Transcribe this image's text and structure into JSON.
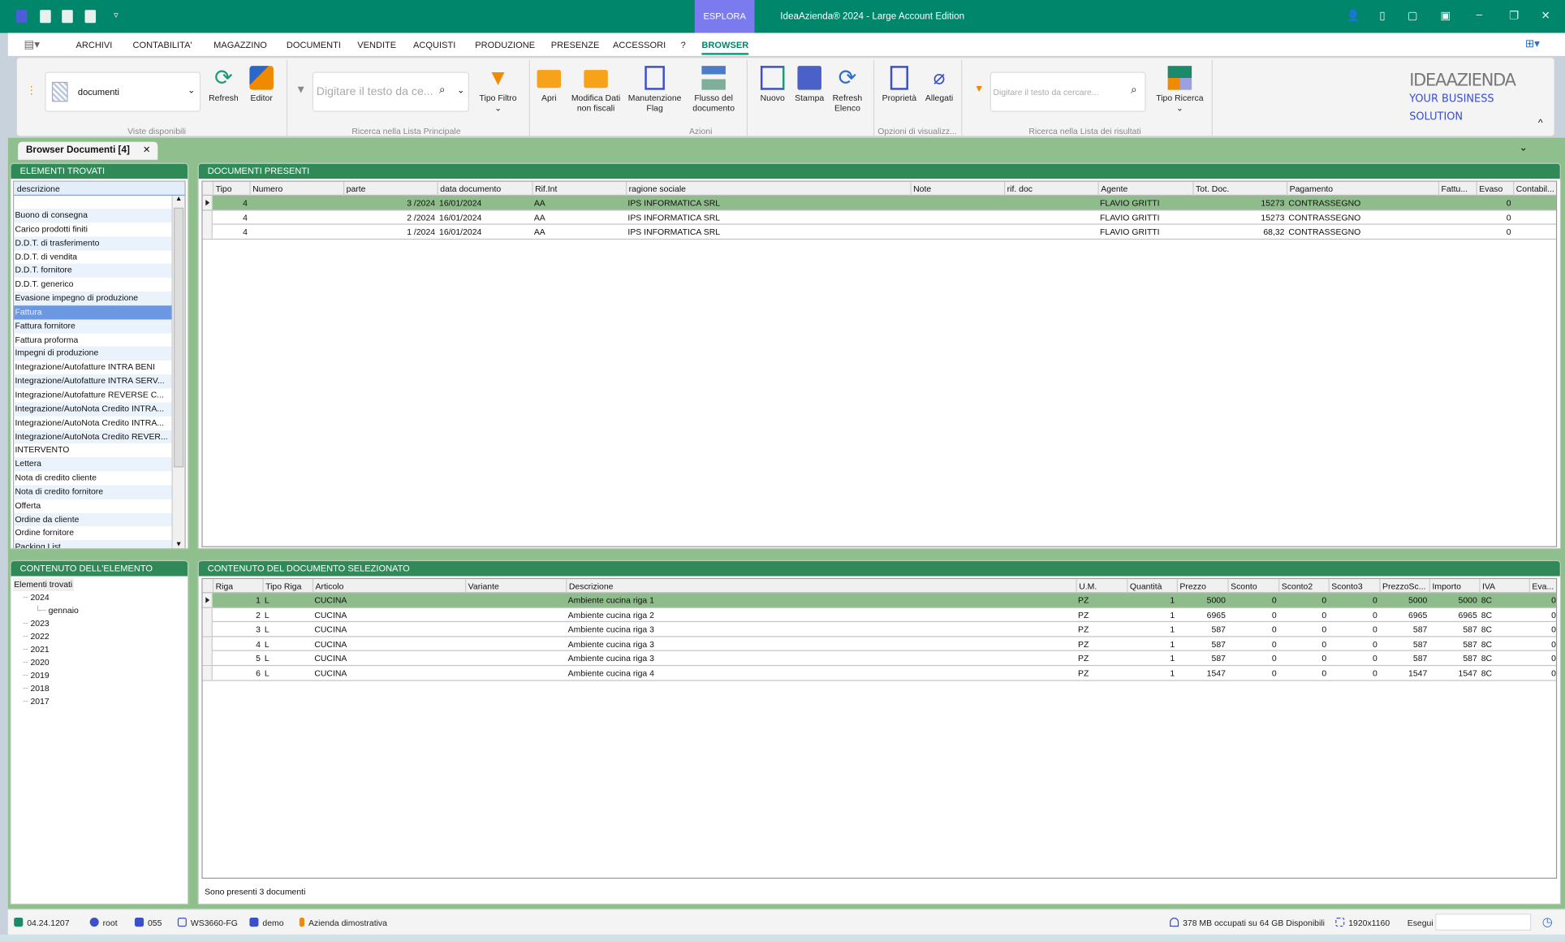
{
  "titlebar": {
    "title": "IdeaAzienda® 2024 - Large Account Edition",
    "context_tab": "ESPLORA",
    "quick_icons": [
      "app-icon",
      "calculator-icon",
      "print-preview-icon",
      "excel-icon",
      "customize-icon"
    ],
    "window_icons": [
      "user-icon",
      "document-search-icon",
      "help-icon",
      "pin-icon",
      "minimize-icon",
      "restore-icon",
      "close-icon"
    ]
  },
  "menu": {
    "items": [
      "ARCHIVI",
      "CONTABILITA'",
      "MAGAZZINO",
      "DOCUMENTI",
      "VENDITE",
      "ACQUISTI",
      "PRODUZIONE",
      "PRESENZE",
      "ACCESSORI",
      "?",
      "BROWSER"
    ],
    "active": "BROWSER"
  },
  "ribbon": {
    "views_combo": "documenti",
    "views_group": "Viste disponibili",
    "refresh": "Refresh",
    "editor": "Editor",
    "search_placeholder": "Digitare il testo da ce...",
    "search_group": "Ricerca nella Lista Principale",
    "filter_type": "Tipo Filtro",
    "actions": {
      "open": "Apri",
      "edit_nonfiscal": "Modifica Dati non fiscali",
      "flag": "Manutenzione Flag",
      "flow": "Flusso del documento",
      "new": "Nuovo",
      "print": "Stampa",
      "refresh_list": "Refresh Elenco"
    },
    "actions_group": "Azioni",
    "properties": "Proprietà",
    "attachments": "Allegati",
    "view_group": "Opzioni di visualizz...",
    "result_search_placeholder": "Digitare il testo da cercare...",
    "result_group": "Ricerca nella Lista dei risultati",
    "search_type": "Tipo Ricerca",
    "logo": "IDEAAZIENDA YOUR BUSINESS SOLUTION"
  },
  "doc_tab": {
    "label": "Browser Documenti [4]"
  },
  "elements_panel": {
    "title": "ELEMENTI TROVATI",
    "column": "descrizione",
    "selected": "Fattura",
    "items": [
      "Buono di consegna",
      "Carico prodotti finiti",
      "D.D.T. di trasferimento",
      "D.D.T. di vendita",
      "D.D.T. fornitore",
      "D.D.T. generico",
      "Evasione impegno di produzione",
      "Fattura",
      "Fattura fornitore",
      "Fattura proforma",
      "Impegni di produzione",
      "Integrazione/Autofatture INTRA BENI",
      "Integrazione/Autofatture INTRA SERV...",
      "Integrazione/Autofatture REVERSE C...",
      "Integrazione/AutoNota Credito INTRA...",
      "Integrazione/AutoNota Credito INTRA...",
      "Integrazione/AutoNota Credito REVER...",
      "INTERVENTO",
      "Lettera",
      "Nota di credito cliente",
      "Nota di credito fornitore",
      "Offerta",
      "Ordine da cliente",
      "Ordine fornitore",
      "Packing List"
    ]
  },
  "documents_panel": {
    "title": "DOCUMENTI PRESENTI",
    "columns": [
      "Tipo",
      "Numero",
      "parte",
      "data documento",
      "Rif.Int",
      "ragione sociale",
      "Note",
      "rif. doc",
      "Agente",
      "Tot. Doc.",
      "Pagamento",
      "Fattu...",
      "Evaso",
      "Contabil..."
    ],
    "rows": [
      [
        "4",
        "",
        "3 /2024",
        "16/01/2024",
        "AA",
        "IPS INFORMATICA SRL",
        "",
        "",
        "FLAVIO GRITTI",
        "15273",
        "CONTRASSEGNO",
        "",
        "0",
        ""
      ],
      [
        "4",
        "",
        "2 /2024",
        "16/01/2024",
        "AA",
        "IPS INFORMATICA SRL",
        "",
        "",
        "FLAVIO GRITTI",
        "15273",
        "CONTRASSEGNO",
        "",
        "0",
        ""
      ],
      [
        "4",
        "",
        "1 /2024",
        "16/01/2024",
        "AA",
        "IPS INFORMATICA SRL",
        "",
        "",
        "FLAVIO GRITTI",
        "68,32",
        "CONTRASSEGNO",
        "",
        "0",
        ""
      ]
    ]
  },
  "tree_panel": {
    "title": "CONTENUTO DELL'ELEMENTO SCELTO",
    "root": "Elementi trovati",
    "nodes": [
      {
        "label": "2024",
        "level": 1
      },
      {
        "label": "gennaio",
        "level": 2
      },
      {
        "label": "2023",
        "level": 1
      },
      {
        "label": "2022",
        "level": 1
      },
      {
        "label": "2021",
        "level": 1
      },
      {
        "label": "2020",
        "level": 1
      },
      {
        "label": "2019",
        "level": 1
      },
      {
        "label": "2018",
        "level": 1
      },
      {
        "label": "2017",
        "level": 1
      }
    ]
  },
  "lines_panel": {
    "title": "CONTENUTO DEL DOCUMENTO SELEZIONATO",
    "columns": [
      "Riga",
      "Tipo Riga",
      "Articolo",
      "Variante",
      "Descrizione",
      "U.M.",
      "Quantità",
      "Prezzo",
      "Sconto",
      "Sconto2",
      "Sconto3",
      "PrezzoSc...",
      "Importo",
      "IVA",
      "Eva..."
    ],
    "rows": [
      [
        "1",
        "L",
        "CUCINA",
        "",
        "Ambiente cucina riga 1",
        "PZ",
        "1",
        "5000",
        "0",
        "0",
        "0",
        "5000",
        "5000",
        "8C",
        "0"
      ],
      [
        "2",
        "L",
        "CUCINA",
        "",
        "Ambiente cucina riga 2",
        "PZ",
        "1",
        "6965",
        "0",
        "0",
        "0",
        "6965",
        "6965",
        "8C",
        "0"
      ],
      [
        "3",
        "L",
        "CUCINA",
        "",
        "Ambiente cucina riga 3",
        "PZ",
        "1",
        "587",
        "0",
        "0",
        "0",
        "587",
        "587",
        "8C",
        "0"
      ],
      [
        "4",
        "L",
        "CUCINA",
        "",
        "Ambiente cucina riga 3",
        "PZ",
        "1",
        "587",
        "0",
        "0",
        "0",
        "587",
        "587",
        "8C",
        "0"
      ],
      [
        "5",
        "L",
        "CUCINA",
        "",
        "Ambiente cucina riga 3",
        "PZ",
        "1",
        "587",
        "0",
        "0",
        "0",
        "587",
        "587",
        "8C",
        "0"
      ],
      [
        "6",
        "L",
        "CUCINA",
        "",
        "Ambiente cucina riga 4",
        "PZ",
        "1",
        "1547",
        "0",
        "0",
        "0",
        "1547",
        "1547",
        "8C",
        "0"
      ]
    ],
    "footer": "Sono presenti 3 documenti"
  },
  "statusbar": {
    "version": "04.24.1207",
    "user": "root",
    "code": "055",
    "workstation": "WS3660-FG",
    "database": "demo",
    "company": "Azienda dimostrativa",
    "memory": "378 MB occupati su 64 GB Disponibili",
    "resolution": "1920x1160",
    "run_label": "Esegui",
    "run_value": ""
  },
  "colors": {
    "titlebar": "#00866b",
    "context_tab": "#7b7bef",
    "panel_header": "#2f8a57",
    "selected_row": "#8fbc8b",
    "selected_item": "#6b98e0"
  }
}
